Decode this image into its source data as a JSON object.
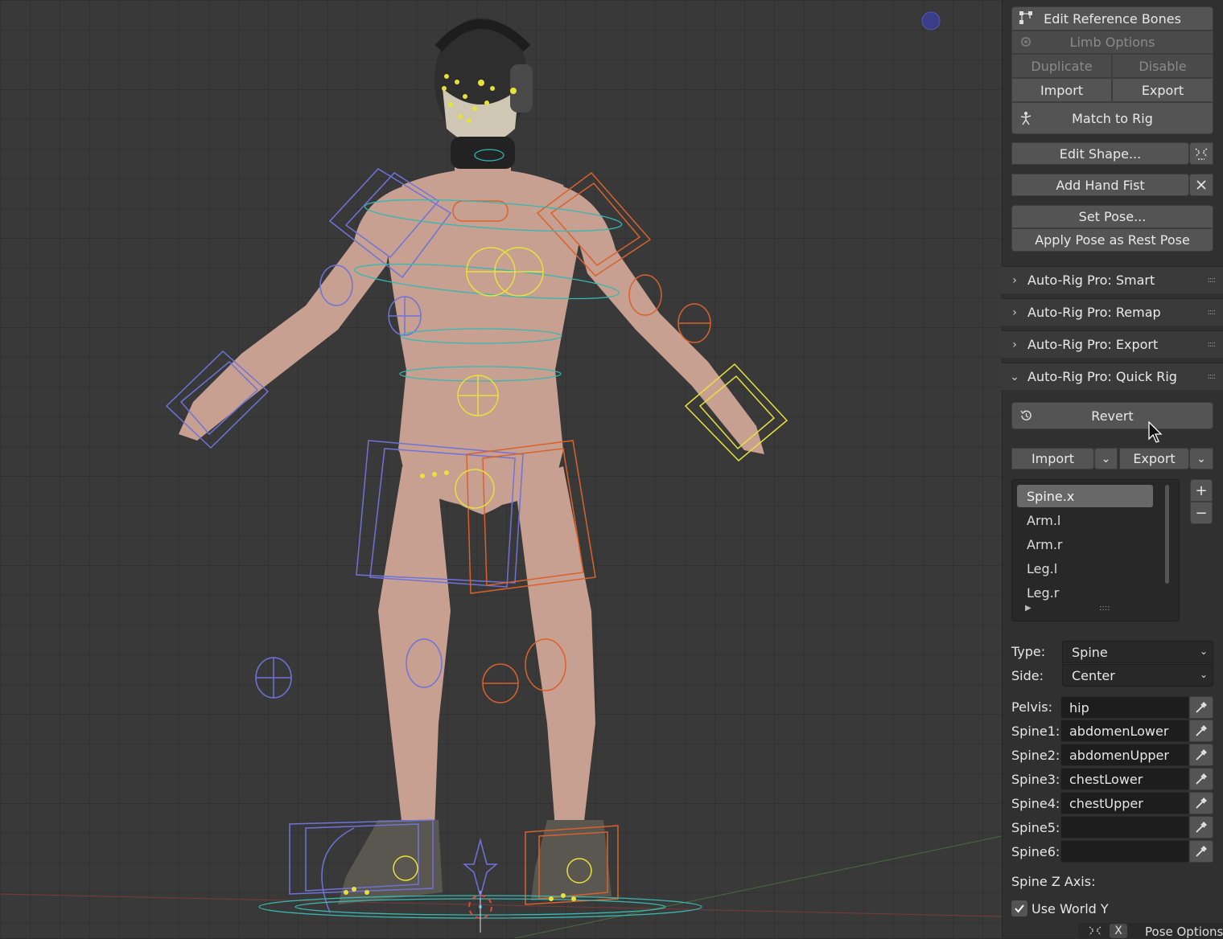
{
  "rig_tools": {
    "edit_reference_bones": "Edit Reference Bones",
    "limb_options": "Limb Options",
    "duplicate": "Duplicate",
    "disable": "Disable",
    "import": "Import",
    "export": "Export",
    "match_to_rig": "Match to Rig",
    "edit_shape": "Edit Shape...",
    "add_hand_fist": "Add Hand Fist",
    "set_pose": "Set Pose...",
    "apply_pose_as_rest_pose": "Apply Pose as Rest Pose"
  },
  "panels": {
    "smart": "Auto-Rig Pro: Smart",
    "remap": "Auto-Rig Pro: Remap",
    "export": "Auto-Rig Pro: Export",
    "quick_rig": "Auto-Rig Pro: Quick Rig"
  },
  "quick_rig": {
    "revert": "Revert",
    "import": "Import",
    "export": "Export",
    "limbs": [
      "Spine.x",
      "Arm.l",
      "Arm.r",
      "Leg.l",
      "Leg.r"
    ],
    "selected_limb": "Spine.x",
    "type_label": "Type:",
    "type_value": "Spine",
    "side_label": "Side:",
    "side_value": "Center",
    "bones": [
      {
        "label": "Pelvis:",
        "value": "hip"
      },
      {
        "label": "Spine1:",
        "value": "abdomenLower"
      },
      {
        "label": "Spine2:",
        "value": "abdomenUpper"
      },
      {
        "label": "Spine3:",
        "value": "chestLower"
      },
      {
        "label": "Spine4:",
        "value": "chestUpper"
      },
      {
        "label": "Spine5:",
        "value": ""
      },
      {
        "label": "Spine6:",
        "value": ""
      }
    ],
    "spine_z_axis_label": "Spine Z Axis:",
    "use_world_y_label": "Use World Y",
    "use_world_y_checked": true
  },
  "statusbar": {
    "key_hint": "X",
    "pose_options": "Pose Options"
  },
  "colors": {
    "rig_blue": "#6f73d9",
    "rig_orange": "#d9622b",
    "rig_yellow": "#e6e23a",
    "rig_cyan": "#37b8b0",
    "skin": "#c9a091"
  }
}
